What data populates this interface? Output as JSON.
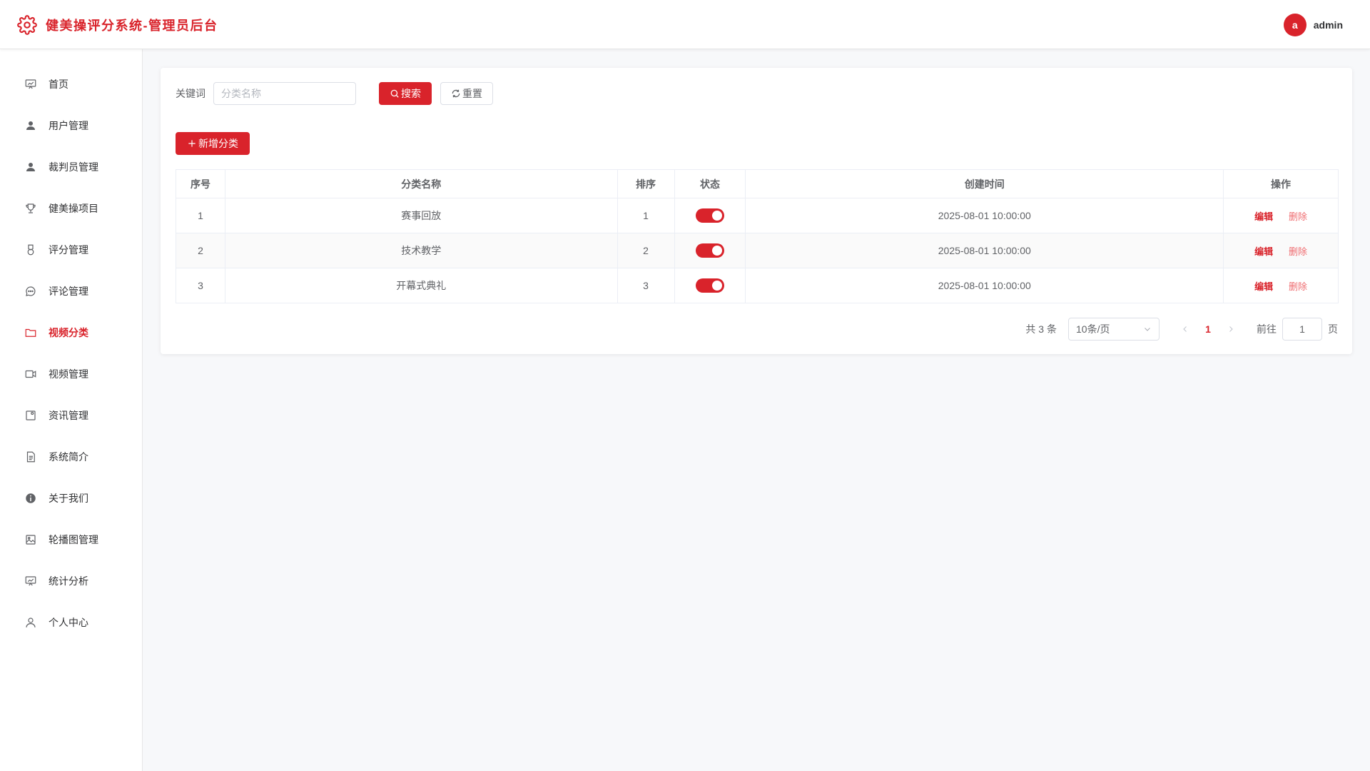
{
  "header": {
    "title": "健美操评分系统-管理员后台",
    "avatar_letter": "a",
    "username": "admin",
    "accent_color": "#d9232b"
  },
  "sidebar": {
    "items": [
      {
        "label": "首页",
        "icon": "dashboard-icon",
        "active": false
      },
      {
        "label": "用户管理",
        "icon": "user-icon",
        "active": false
      },
      {
        "label": "裁判员管理",
        "icon": "user-icon",
        "active": false
      },
      {
        "label": "健美操项目",
        "icon": "trophy-icon",
        "active": false
      },
      {
        "label": "评分管理",
        "icon": "medal-icon",
        "active": false
      },
      {
        "label": "评论管理",
        "icon": "chat-icon",
        "active": false
      },
      {
        "label": "视频分类",
        "icon": "folder-icon",
        "active": true
      },
      {
        "label": "视频管理",
        "icon": "video-camera-icon",
        "active": false
      },
      {
        "label": "资讯管理",
        "icon": "news-icon",
        "active": false
      },
      {
        "label": "系统简介",
        "icon": "document-icon",
        "active": false
      },
      {
        "label": "关于我们",
        "icon": "info-icon",
        "active": false
      },
      {
        "label": "轮播图管理",
        "icon": "picture-icon",
        "active": false
      },
      {
        "label": "统计分析",
        "icon": "data-board-icon",
        "active": false
      },
      {
        "label": "个人中心",
        "icon": "user-outline-icon",
        "active": false
      }
    ]
  },
  "search": {
    "label": "关键词",
    "placeholder": "分类名称",
    "value": "",
    "search_button": "搜索",
    "reset_button": "重置"
  },
  "toolbar": {
    "add_button": "新增分类"
  },
  "table": {
    "columns": [
      "序号",
      "分类名称",
      "排序",
      "状态",
      "创建时间",
      "操作"
    ],
    "rows": [
      {
        "index": "1",
        "name": "赛事回放",
        "sort": "1",
        "status_on": true,
        "created": "2025-08-01 10:00:00",
        "edit": "编辑",
        "delete": "删除"
      },
      {
        "index": "2",
        "name": "技术教学",
        "sort": "2",
        "status_on": true,
        "created": "2025-08-01 10:00:00",
        "edit": "编辑",
        "delete": "删除"
      },
      {
        "index": "3",
        "name": "开幕式典礼",
        "sort": "3",
        "status_on": true,
        "created": "2025-08-01 10:00:00",
        "edit": "编辑",
        "delete": "删除"
      }
    ]
  },
  "pagination": {
    "total_text": "共 3 条",
    "page_size": "10条/页",
    "current_page": "1",
    "goto_label": "前往",
    "goto_value": "1",
    "page_suffix": "页"
  }
}
